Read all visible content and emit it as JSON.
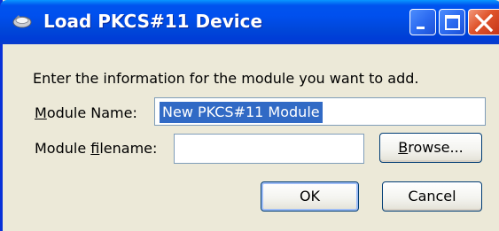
{
  "window": {
    "title": "Load PKCS#11 Device",
    "titlebar_color": "#0054e3",
    "icons": {
      "app": "app-icon",
      "minimize": "minimize-icon",
      "maximize": "maximize-icon",
      "close": "close-icon"
    }
  },
  "dialog": {
    "instruction": "Enter the information for the module you want to add.",
    "module_name": {
      "label_first": "M",
      "label_rest": "odule Name:",
      "value": "New PKCS#11 Module"
    },
    "module_filename": {
      "label_pre": "Module ",
      "label_u": "f",
      "label_post": "ilename:",
      "value": ""
    },
    "browse": {
      "u": "B",
      "rest": "rowse..."
    },
    "ok_label": "OK",
    "cancel_label": "Cancel"
  }
}
